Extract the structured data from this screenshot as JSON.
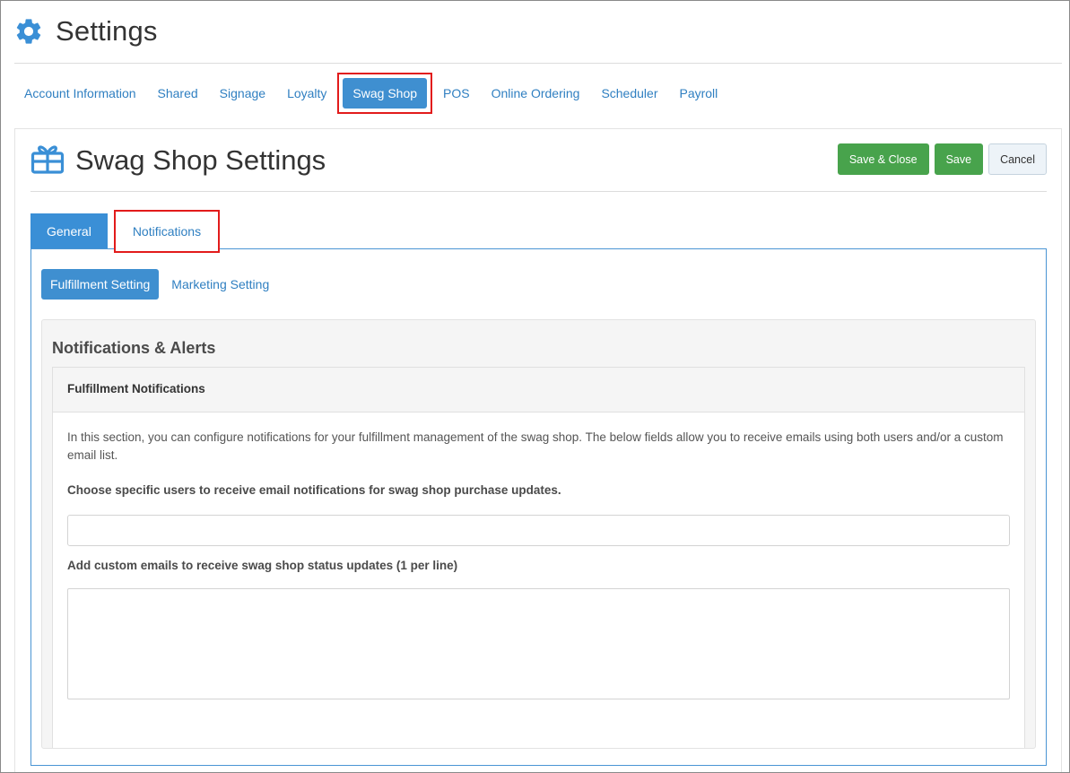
{
  "page": {
    "title": "Settings"
  },
  "nav": {
    "items": [
      {
        "label": "Account Information"
      },
      {
        "label": "Shared"
      },
      {
        "label": "Signage"
      },
      {
        "label": "Loyalty"
      },
      {
        "label": "Swag Shop",
        "active": true
      },
      {
        "label": "POS"
      },
      {
        "label": "Online Ordering"
      },
      {
        "label": "Scheduler"
      },
      {
        "label": "Payroll"
      }
    ]
  },
  "panel": {
    "title": "Swag Shop Settings",
    "actions": {
      "save_close": "Save & Close",
      "save": "Save",
      "cancel": "Cancel"
    }
  },
  "tabs": [
    {
      "label": "General",
      "active": true
    },
    {
      "label": "Notifications"
    }
  ],
  "subtabs": [
    {
      "label": "Fulfillment Setting",
      "active": true
    },
    {
      "label": "Marketing Setting"
    }
  ],
  "section": {
    "title": "Notifications & Alerts",
    "panel_heading": "Fulfillment Notifications",
    "description": "In this section, you can configure notifications for your fulfillment management of the swag shop. The below fields allow you to receive emails using both users and/or a custom email list.",
    "users_label": "Choose specific users to receive email notifications for swag shop purchase updates.",
    "users_value": "",
    "emails_label": "Add custom emails to receive swag shop status updates (1 per line)",
    "emails_value": ""
  },
  "colors": {
    "link": "#2f7fc1",
    "active_tab": "#3a8fd6",
    "success": "#48a34c",
    "highlight": "#e21b1b"
  },
  "icons": {
    "page": "gear-icon",
    "panel": "gift-icon"
  }
}
